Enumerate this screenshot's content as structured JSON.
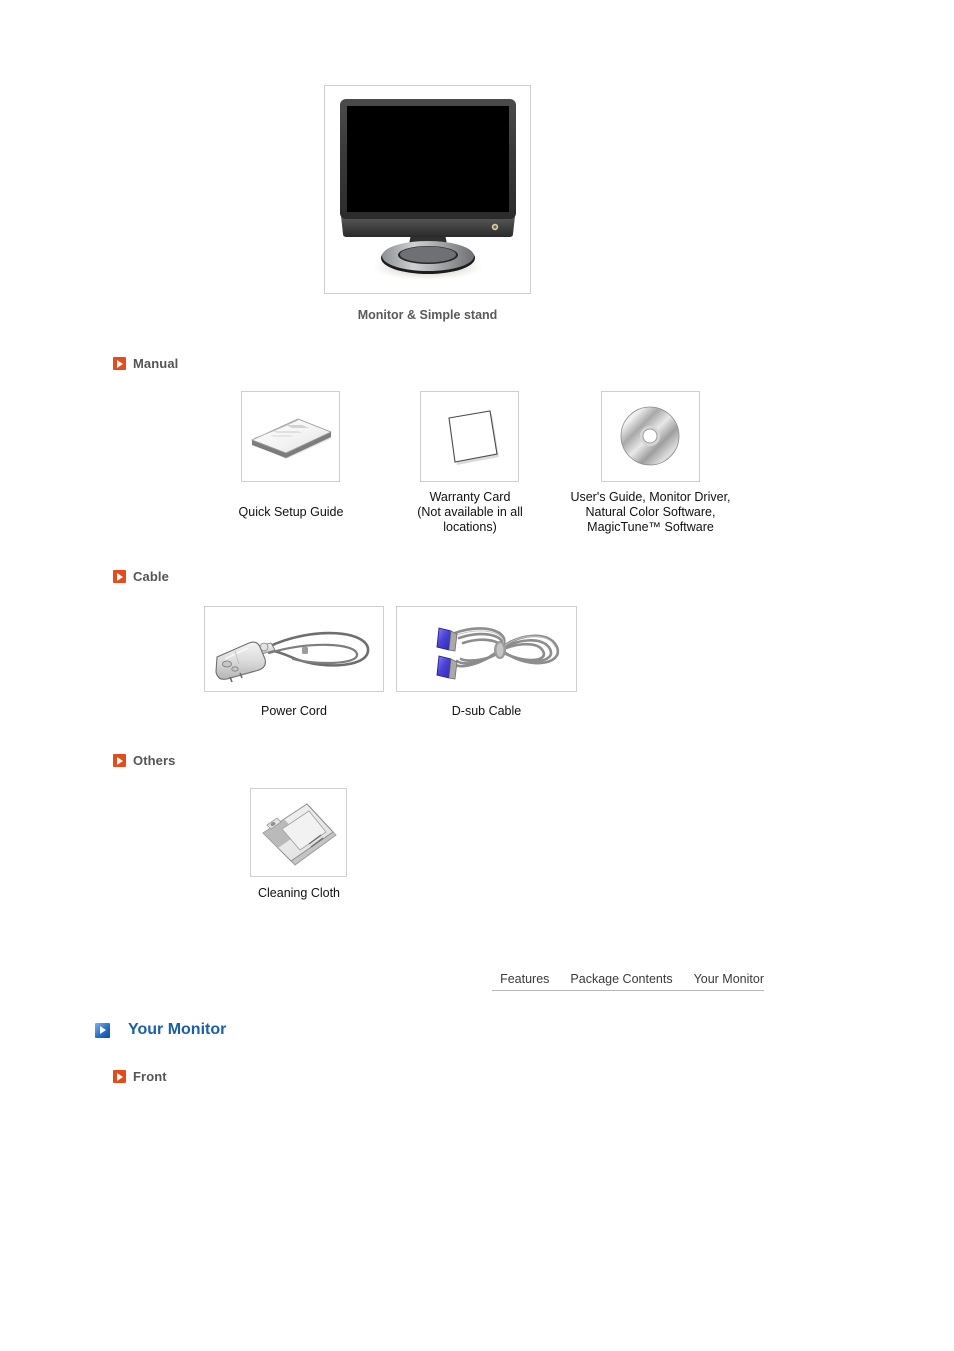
{
  "page": {
    "hero": {
      "caption": "Monitor & Simple stand",
      "image_name": "monitor-and-simple-stand"
    },
    "sections": [
      {
        "id": "manual",
        "label": "Manual",
        "icon": "orange-arrow-icon",
        "items": [
          {
            "id": "quick-setup-guide",
            "caption": "Quick Setup Guide",
            "image_name": "quick-setup-guide-booklet"
          },
          {
            "id": "warranty-card",
            "caption": "Warranty Card\n(Not available in all\nlocations)",
            "image_name": "warranty-card-sheet"
          },
          {
            "id": "software-cd",
            "caption": "User's Guide, Monitor Driver,\nNatural Color Software,\nMagicTune™ Software",
            "image_name": "cd-disc"
          }
        ]
      },
      {
        "id": "cable",
        "label": "Cable",
        "icon": "orange-arrow-icon",
        "items": [
          {
            "id": "power-cord",
            "caption": "Power Cord",
            "image_name": "power-cord"
          },
          {
            "id": "dsub-cable",
            "caption": "D-sub Cable",
            "image_name": "d-sub-cable"
          }
        ]
      },
      {
        "id": "others",
        "label": "Others",
        "icon": "orange-arrow-icon",
        "items": [
          {
            "id": "cleaning-cloth",
            "caption": "Cleaning Cloth",
            "image_name": "cleaning-cloth"
          }
        ]
      }
    ],
    "nav": {
      "links": [
        {
          "id": "features",
          "label": "Features"
        },
        {
          "id": "package-contents",
          "label": "Package Contents"
        },
        {
          "id": "your-monitor",
          "label": "Your Monitor"
        }
      ]
    },
    "your_monitor": {
      "heading": "Your Monitor",
      "icon": "blue-arrow-icon",
      "subsection": {
        "id": "front",
        "label": "Front",
        "icon": "orange-arrow-icon"
      }
    },
    "colors": {
      "accent_orange": "#E34C1C",
      "accent_blue": "#1a5FA8",
      "header_gray": "#555555",
      "frame_border": "#cfcfcf"
    }
  }
}
